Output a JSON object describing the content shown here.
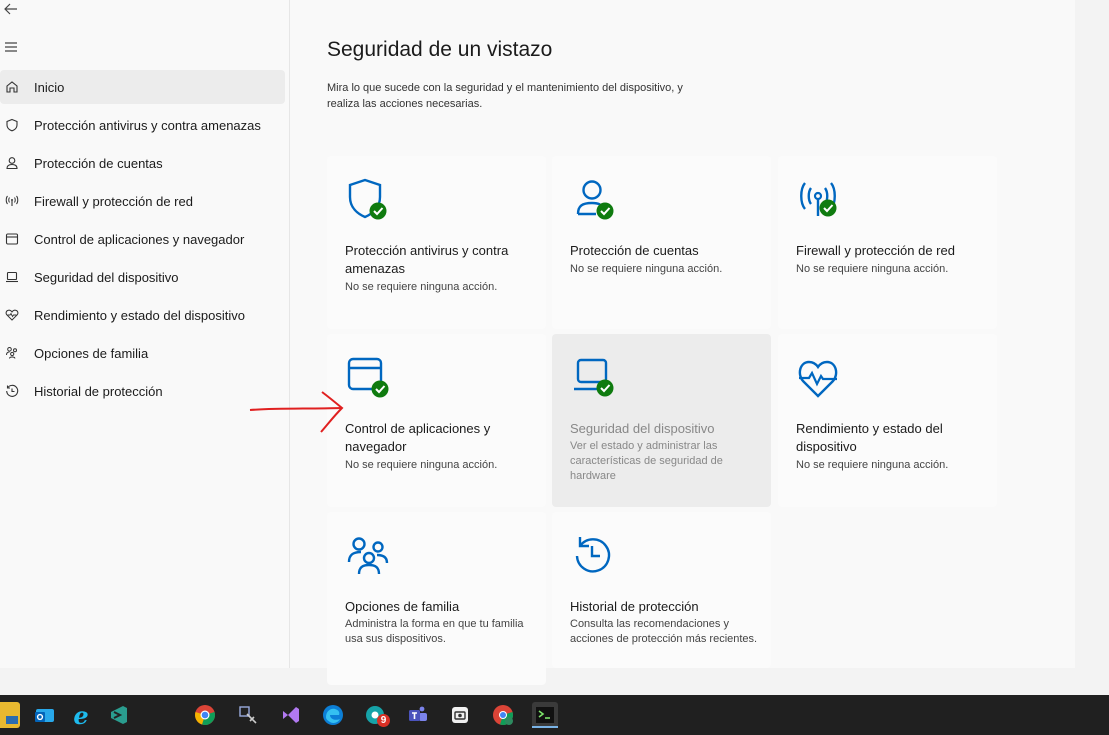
{
  "sidebar": {
    "back_icon": "back-arrow-icon",
    "menu_icon": "hamburger-menu-icon",
    "items": [
      {
        "label": "Inicio",
        "icon": "home-icon",
        "active": true
      },
      {
        "label": "Protección antivirus y contra amenazas",
        "icon": "shield-icon"
      },
      {
        "label": "Protección de cuentas",
        "icon": "person-icon"
      },
      {
        "label": "Firewall y protección de red",
        "icon": "wifi-antenna-icon"
      },
      {
        "label": "Control de aplicaciones y navegador",
        "icon": "browser-window-icon"
      },
      {
        "label": "Seguridad del dispositivo",
        "icon": "laptop-icon"
      },
      {
        "label": "Rendimiento y estado del dispositivo",
        "icon": "heart-pulse-icon"
      },
      {
        "label": "Opciones de familia",
        "icon": "family-icon"
      },
      {
        "label": "Historial de protección",
        "icon": "history-icon"
      }
    ]
  },
  "main": {
    "title": "Seguridad de un vistazo",
    "subtitle": "Mira lo que sucede con la seguridad y el mantenimiento del dispositivo, y realiza las acciones necesarias.",
    "cards": [
      {
        "title": "Protección antivirus y contra amenazas",
        "desc": "No se requiere ninguna acción.",
        "icon": "shield-check-icon"
      },
      {
        "title": "Protección de cuentas",
        "desc": "No se requiere ninguna acción.",
        "icon": "person-check-icon"
      },
      {
        "title": "Firewall y protección de red",
        "desc": "No se requiere ninguna acción.",
        "icon": "antenna-check-icon"
      },
      {
        "title": "Control de aplicaciones y navegador",
        "desc": "No se requiere ninguna acción.",
        "icon": "browser-check-icon"
      },
      {
        "title": "Seguridad del dispositivo",
        "desc": "Ver el estado y administrar las características de seguridad de hardware",
        "icon": "laptop-check-icon"
      },
      {
        "title": "Rendimiento y estado del dispositivo",
        "desc": "No se requiere ninguna acción.",
        "icon": "heart-pulse-icon"
      },
      {
        "title": "Opciones de familia",
        "desc": "Administra la forma en que tu familia usa sus dispositivos.",
        "icon": "family-icon"
      },
      {
        "title": "Historial de protección",
        "desc": "Consulta las recomendaciones y acciones de protección más recientes.",
        "icon": "history-icon"
      }
    ]
  },
  "taskbar": {
    "badge_count": "9",
    "icons": [
      "file-explorer-icon",
      "outlook-icon",
      "internet-explorer-icon",
      "visual-studio-code-icon",
      "chrome-icon",
      "snipping-tool-icon",
      "visual-studio-icon",
      "edge-icon",
      "chrome-badge-icon",
      "teams-icon",
      "camera-app-icon",
      "chrome-profile-icon",
      "terminal-icon"
    ]
  },
  "colors": {
    "accent": "#0067c0",
    "check_green": "#0f7b0f",
    "annotation_red": "#e02020",
    "taskbar_bg": "#202020"
  }
}
